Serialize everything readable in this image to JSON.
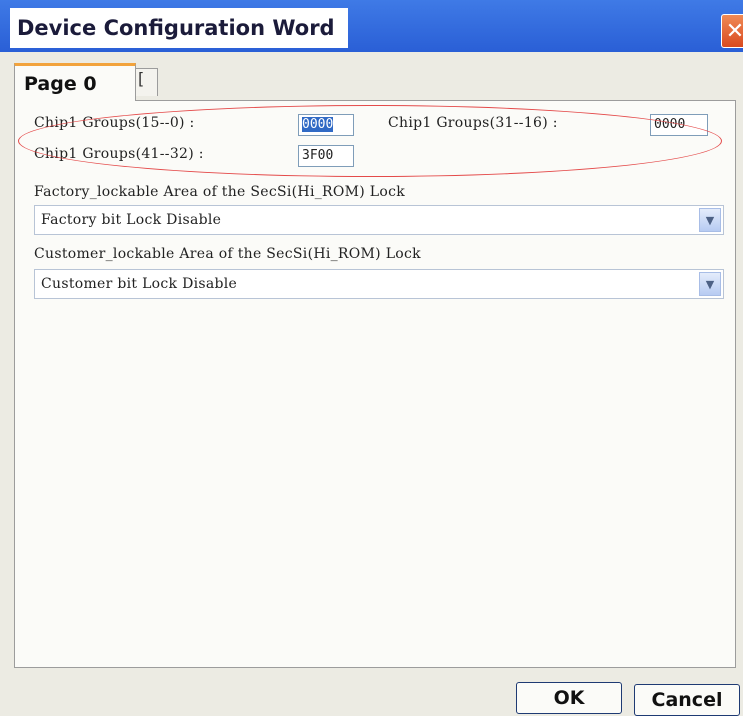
{
  "window": {
    "title": "Device Configuration Word",
    "close_glyph": "✕"
  },
  "tabs": [
    {
      "label": "Page 0",
      "active": true
    },
    {
      "label": "[",
      "active": false
    }
  ],
  "groups": {
    "g1_label": "Chip1 Groups(15--0) :",
    "g1_value": "0000",
    "g2_label": "Chip1 Groups(31--16) :",
    "g2_value": "0000",
    "g3_label": "Chip1 Groups(41--32) :",
    "g3_value": "3F00"
  },
  "factory": {
    "label": "Factory_lockable Area of the SecSi(Hi_ROM) Lock",
    "selected": "Factory bit Lock Disable"
  },
  "customer": {
    "label": "Customer_lockable Area of the SecSi(Hi_ROM) Lock",
    "selected": "Customer bit Lock Disable"
  },
  "buttons": {
    "ok": "OK",
    "cancel": "Cancel"
  },
  "icons": {
    "dropdown": "chevron-down-icon",
    "close": "close-icon"
  },
  "colors": {
    "titlebar": "#2a5fd6",
    "highlight_ellipse": "#e44a4a",
    "tab_accent": "#f2a33c",
    "selection": "#316ac5"
  }
}
